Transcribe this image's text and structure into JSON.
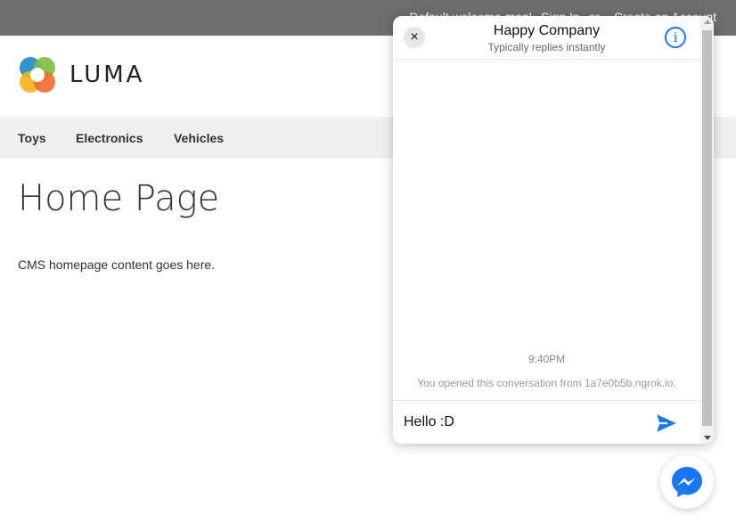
{
  "topbar": {
    "welcome": "Default welcome msg!",
    "sign_in": "Sign In",
    "or": "or",
    "create_account": "Create an Account"
  },
  "logo": {
    "text": "LUMA"
  },
  "nav": {
    "items": [
      {
        "label": "Toys"
      },
      {
        "label": "Electronics"
      },
      {
        "label": "Vehicles"
      }
    ]
  },
  "page": {
    "title": "Home Page",
    "content": "CMS homepage content goes here."
  },
  "chat": {
    "title": "Happy Company",
    "subtitle": "Typically replies instantly",
    "close_icon": "×",
    "info_icon": "i",
    "timestamp": "9:40PM",
    "opened_note": "You opened this conversation from 1a7e0b5b.ngrok.io.",
    "input_value": "Hello :D"
  },
  "colors": {
    "topbar": "#6e6e6d",
    "nav": "#efefef",
    "messenger_blue": "#1877f2"
  }
}
